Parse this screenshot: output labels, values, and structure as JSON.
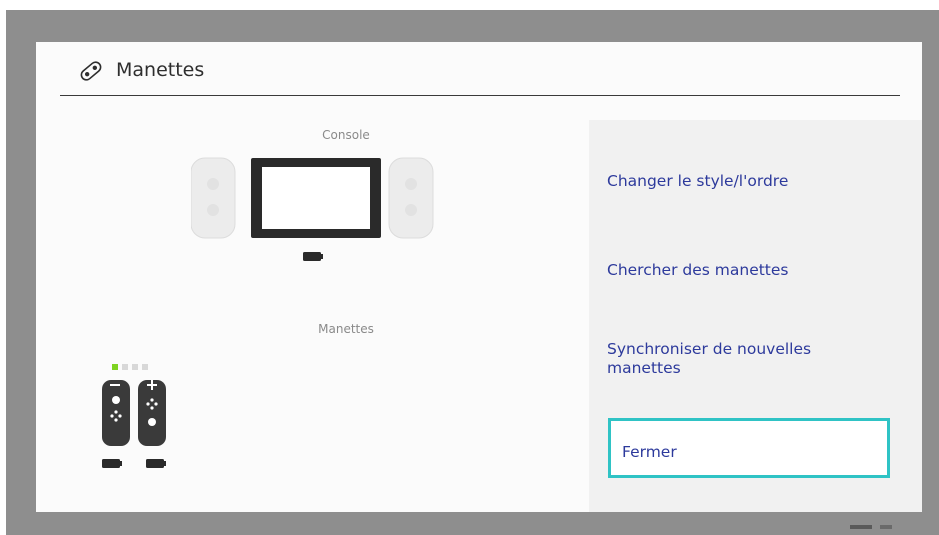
{
  "header": {
    "title": "Manettes",
    "icon": "controller-icon"
  },
  "console_section": {
    "label": "Console"
  },
  "controllers_section": {
    "label": "Manettes",
    "player_indicator_active": 1,
    "player_indicator_total": 4
  },
  "menu": {
    "items": [
      {
        "label": "Changer le style/l'ordre"
      },
      {
        "label": "Chercher des manettes"
      },
      {
        "label": "Synchroniser de nouvelles manettes"
      },
      {
        "label": "Fermer"
      }
    ]
  },
  "colors": {
    "accent_text": "#2d3a9c",
    "focus_border": "#2fc3c5",
    "player_led_active": "#7ed321"
  }
}
